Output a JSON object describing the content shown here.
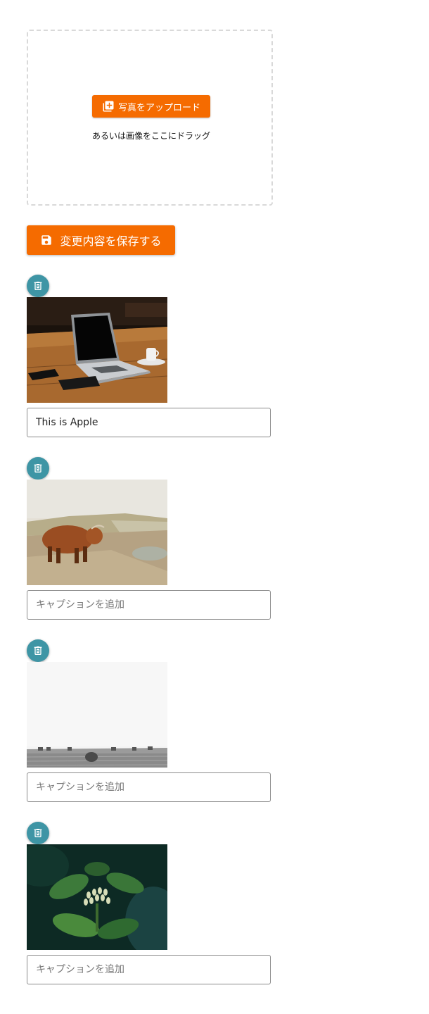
{
  "upload": {
    "button_label": "写真をアップロード",
    "icon": "add-photo-icon",
    "hint": "あるいは画像をここにドラッグ"
  },
  "save": {
    "button_label": "変更内容を保存する",
    "icon": "floppy-disk-icon"
  },
  "photos": [
    {
      "subject": "laptop-on-desk",
      "caption_value": "This is Apple",
      "caption_placeholder": "キャプションを追加"
    },
    {
      "subject": "highland-cow-on-cliff",
      "caption_value": "",
      "caption_placeholder": "キャプションを追加"
    },
    {
      "subject": "hay-bales-field",
      "caption_value": "",
      "caption_placeholder": "キャプションを追加"
    },
    {
      "subject": "green-plant-buds",
      "caption_value": "",
      "caption_placeholder": "キャプションを追加"
    }
  ],
  "colors": {
    "accent": "#f56b00",
    "delete_button": "#3e95a5",
    "dropzone_border": "#d9d9d9"
  }
}
